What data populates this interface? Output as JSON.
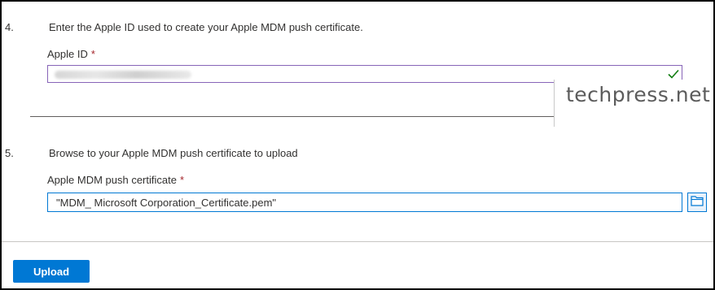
{
  "step4": {
    "number": "4.",
    "instruction": "Enter the Apple ID used to create your Apple MDM push certificate.",
    "field_label": "Apple ID",
    "required_marker": "*"
  },
  "watermark": "techpress.net",
  "step5": {
    "number": "5.",
    "instruction": "Browse to your Apple MDM push certificate to upload",
    "field_label": "Apple MDM push certificate",
    "required_marker": "*",
    "file_value": "\"MDM_ Microsoft Corporation_Certificate.pem\""
  },
  "actions": {
    "upload_label": "Upload"
  },
  "colors": {
    "accent": "#0078d4",
    "required": "#a4262c",
    "valid_check": "#107c10",
    "apple_id_border": "#8764b8"
  },
  "icons": {
    "valid": "checkmark-icon",
    "browse": "folder-icon"
  }
}
